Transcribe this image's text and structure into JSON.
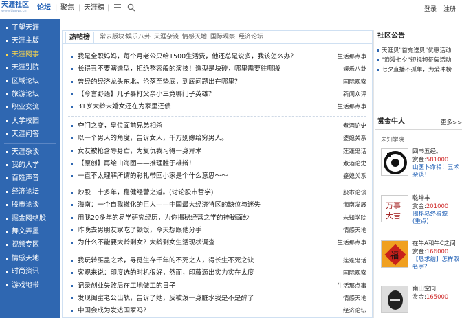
{
  "header": {
    "logo_text": "天涯社区",
    "logo_url_text": "www.tianya.cn",
    "nav_forum": "论坛",
    "nav_focus": "聚焦",
    "nav_rank": "天涯榜",
    "sep": "|",
    "login": "登录",
    "register": "注册",
    "menu_icon": "menu-icon",
    "search_icon": "search-icon"
  },
  "sidebar": {
    "items": [
      {
        "label": "了望天涯",
        "active": false
      },
      {
        "label": "天涯主版",
        "active": false
      },
      {
        "label": "天涯网事",
        "active": true
      },
      {
        "label": "天涯别院",
        "active": false
      },
      {
        "label": "区域论坛",
        "active": false
      },
      {
        "label": "旅游论坛",
        "active": false
      },
      {
        "label": "职业交流",
        "active": false
      },
      {
        "label": "大学校园",
        "active": false
      },
      {
        "label": "天涯问答",
        "active": false
      },
      {
        "label": "天涯杂谈",
        "active": false
      },
      {
        "label": "我的大学",
        "active": false
      },
      {
        "label": "百姓声音",
        "active": false
      },
      {
        "label": "经济论坛",
        "active": false
      },
      {
        "label": "股市论谈",
        "active": false
      },
      {
        "label": "掘金网络股",
        "active": false
      },
      {
        "label": "舞文弄墨",
        "active": false
      },
      {
        "label": "视频专区",
        "active": false
      },
      {
        "label": "情感天地",
        "active": false
      },
      {
        "label": "时尚资讯",
        "active": false
      },
      {
        "label": "游戏地带",
        "active": false
      }
    ],
    "colors": {
      "bg": "#2f67b1",
      "active": "#ffd84a"
    }
  },
  "main": {
    "tab_hot": "热帖榜",
    "tab_common": "常去版块:",
    "sublinks": [
      "娱乐八卦",
      "天涯杂谈",
      "情感天地",
      "国际观察",
      "经济论坛"
    ],
    "groups": [
      [
        {
          "title": "我是全职妈妈，每个月老公只给1500生活费，他还总是说多，我该怎么办？",
          "cat": "生活那点事"
        },
        {
          "title": "长得丑不要瞎造型，拒绝整容般的演技！造型是块砖，哪里需要往哪搬",
          "cat": "娱乐八卦"
        },
        {
          "title": "曾经的经济龙头东北，沦落至垫底，到底问题出在哪里？",
          "cat": "国际观察"
        },
        {
          "title": "【今言野语】儿子暴打父亲小三竟哪门子英雄？",
          "cat": "新闻众评"
        },
        {
          "title": "31岁大龄未婚女还在为家里还债",
          "cat": "生活那点事"
        }
      ],
      [
        {
          "title": "夺门之变，皇位面前兄弟相杀",
          "cat": "煮酒论史"
        },
        {
          "title": "以一个男人的角度，告诉女人，千万别嫁给穷男人。",
          "cat": "婆媳关系"
        },
        {
          "title": "女友被抢含辱身亡，为复仇我习得一身异术",
          "cat": "莲蓬鬼话"
        },
        {
          "title": "【原创】再绘山海图——推理胜于雄辩！",
          "cat": "煮酒论史"
        },
        {
          "title": "一直不太理解所谓的彩礼带回小家是个什么意思～～",
          "cat": "婆媳关系"
        }
      ],
      [
        {
          "title": "炒股二十多年，稳健经营之道。(讨论股市哲学)",
          "cat": "股市论谈"
        },
        {
          "title": "海南：一个自我撒化的巨人——中国最大经济特区的缺位与迷失",
          "cat": "海南发展"
        },
        {
          "title": "用我20多年的易学研究经历，为你揭秘经营之学的神秘面纱",
          "cat": "未知学院"
        },
        {
          "title": "昨晚去男朋友家吃了顿饭，今天想跟他分手",
          "cat": "情感天地"
        },
        {
          "title": "为什么不能要大龄剩女？大龄剩女生活现状调查",
          "cat": "生活那点事"
        }
      ],
      [
        {
          "title": "我玩转巫蛊之术，寻觅生存千年的不死之人，得长生不死之诀",
          "cat": "莲蓬鬼话"
        },
        {
          "title": "客观来说：印度选的时机很好，然而，印藤源出实力实在太度",
          "cat": "国际观察"
        },
        {
          "title": "记录创业失败后在工地做工的日子",
          "cat": "生活那点事"
        },
        {
          "title": "发现闺蜜老公出轨，告诉了她，反被泼一身脏水我是不是醉了",
          "cat": "情感天地"
        },
        {
          "title": "中国会成为发达国家吗？",
          "cat": "经济论坛"
        }
      ]
    ]
  },
  "right": {
    "notice_title": "社区公告",
    "notices": [
      "天涯贝\"首充送贝\"优惠活动",
      "\"浪漫七夕\"短视频征集活动",
      "七夕直播不孤单，为爱冲榜"
    ],
    "rich_title": "赏金牛人",
    "more": "更多>>",
    "unknown_label": "未知学院",
    "reward_label": "赏金:",
    "people": [
      {
        "name": "四书五经。",
        "reward": "581000",
        "desc": "山医卜命相！五术",
        "desc2": "杂谈！"
      },
      {
        "name": "乾坤丰",
        "reward": "201000",
        "desc": "揭秘易经根源",
        "desc2": "(重点)"
      },
      {
        "name": "在牛A和牛C之间",
        "reward": "166000",
        "desc": "【恳求结】怎样取",
        "desc2": "名字?"
      },
      {
        "name": "南山空同",
        "reward": "165000",
        "desc": "",
        "desc2": ""
      }
    ]
  }
}
